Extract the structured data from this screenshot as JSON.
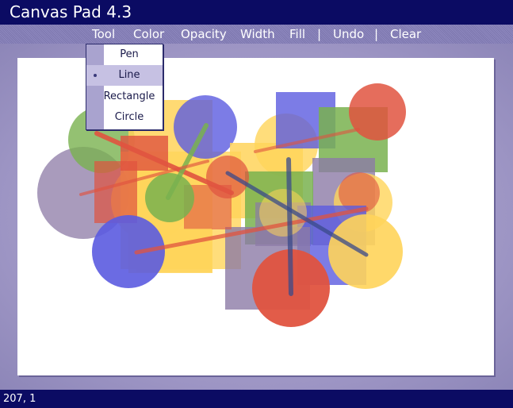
{
  "app": {
    "title": "Canvas Pad 4.3"
  },
  "menu": {
    "items": [
      {
        "label": "Tool"
      },
      {
        "label": "Color"
      },
      {
        "label": "Opacity"
      },
      {
        "label": "Width"
      },
      {
        "label": "Fill"
      },
      {
        "label": "Undo"
      },
      {
        "label": "Clear"
      }
    ],
    "separator": "|"
  },
  "tool_menu": {
    "options": [
      "Pen",
      "Line",
      "Rectangle",
      "Circle"
    ],
    "selected": "Line"
  },
  "status": {
    "cursor": "207, 1"
  },
  "palette": {
    "green": "#79b24f",
    "red": "#e0533f",
    "blue": "#5b5be0",
    "yellow": "#ffd45a",
    "purple": "#8c7aa6",
    "title_bg": "#0b0b63"
  }
}
